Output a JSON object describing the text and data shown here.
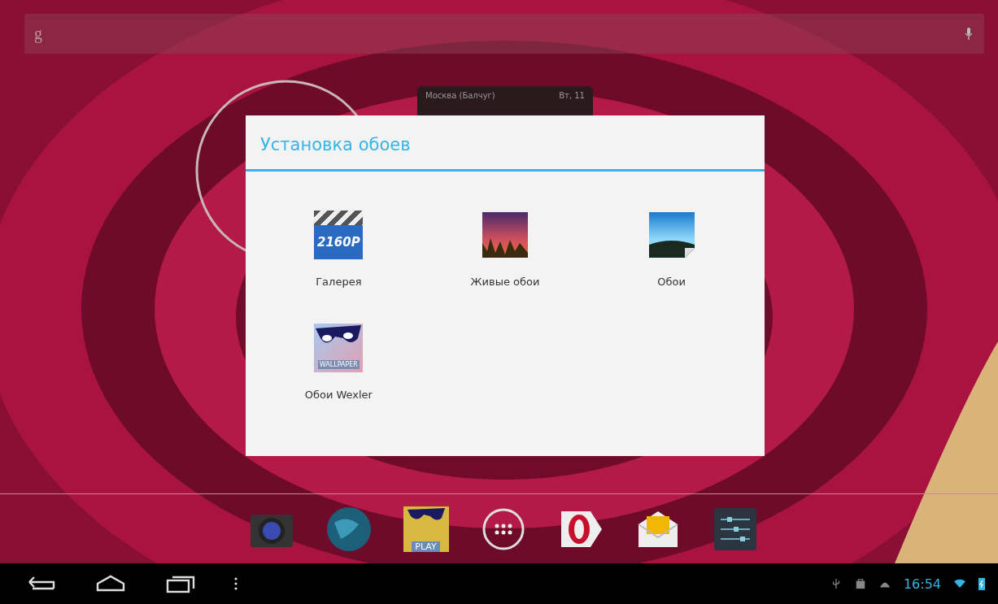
{
  "search_bar": {
    "logo": "g"
  },
  "weather_widget": {
    "city": "Москва (Балчуг)",
    "date": "Вт, 11"
  },
  "dialog": {
    "title": "Установка обоев",
    "options": [
      {
        "kind": "video",
        "label": "Галерея",
        "icon_text": "2160P"
      },
      {
        "kind": "live",
        "label": "Живые обои"
      },
      {
        "kind": "picture",
        "label": "Обои"
      },
      {
        "kind": "wexler",
        "label": "Обои Wexler",
        "icon_text": "WALLPAPER"
      }
    ]
  },
  "dock": [
    {
      "kind": "camera"
    },
    {
      "kind": "globe"
    },
    {
      "kind": "play",
      "text": "PLAY"
    },
    {
      "kind": "apps"
    },
    {
      "kind": "opera"
    },
    {
      "kind": "mail"
    },
    {
      "kind": "settings"
    }
  ],
  "status_bar": {
    "time": "16:54"
  }
}
